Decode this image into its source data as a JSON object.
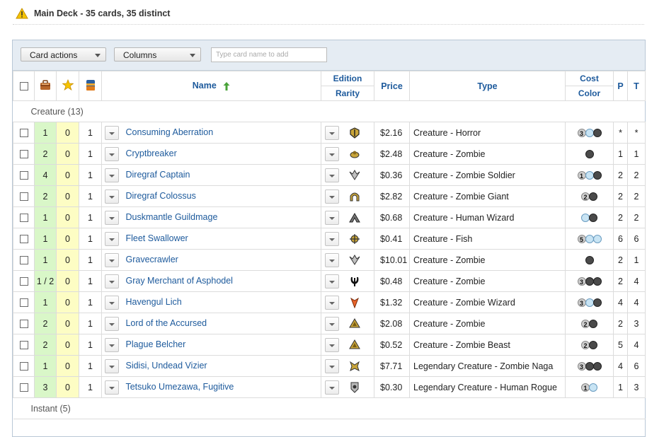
{
  "header": {
    "title": "Main Deck",
    "summary": " - 35 cards, 35 distinct"
  },
  "toolbar": {
    "card_actions_label": "Card actions",
    "columns_label": "Columns",
    "search_placeholder": "Type card name to add"
  },
  "columns": {
    "name": "Name",
    "edition": "Edition",
    "rarity": "Rarity",
    "price": "Price",
    "type": "Type",
    "cost": "Cost",
    "color": "Color",
    "p": "P",
    "t": "T"
  },
  "groups": [
    {
      "label": "Creature (13)"
    },
    {
      "label": "Instant (5)"
    }
  ],
  "colors": {
    "header_text": "#1d5a9c",
    "green_cell": "#d9f7c8",
    "yellow_cell": "#fdfdc4",
    "toolbar_bg": "#e5ecf3"
  },
  "cards": [
    {
      "have": "1",
      "want": "0",
      "qty": "1",
      "name": "Consuming Aberration",
      "edition_icon": "set-icon-gtc",
      "price": "$2.16",
      "type": "Creature - Horror",
      "cost": [
        [
          "num",
          "3"
        ],
        [
          "u",
          ""
        ],
        [
          "b",
          ""
        ]
      ],
      "p": "*",
      "t": "*"
    },
    {
      "have": "2",
      "want": "0",
      "qty": "1",
      "name": "Cryptbreaker",
      "edition_icon": "set-icon-emn",
      "price": "$2.48",
      "type": "Creature - Zombie",
      "cost": [
        [
          "b",
          ""
        ]
      ],
      "p": "1",
      "t": "1"
    },
    {
      "have": "4",
      "want": "0",
      "qty": "1",
      "name": "Diregraf Captain",
      "edition_icon": "set-icon-dka",
      "price": "$0.36",
      "type": "Creature - Zombie Soldier",
      "cost": [
        [
          "num",
          "1"
        ],
        [
          "u",
          ""
        ],
        [
          "b",
          ""
        ]
      ],
      "p": "2",
      "t": "2"
    },
    {
      "have": "2",
      "want": "0",
      "qty": "1",
      "name": "Diregraf Colossus",
      "edition_icon": "set-icon-soi",
      "price": "$2.82",
      "type": "Creature - Zombie Giant",
      "cost": [
        [
          "num",
          "2"
        ],
        [
          "b",
          ""
        ]
      ],
      "p": "2",
      "t": "2"
    },
    {
      "have": "1",
      "want": "0",
      "qty": "1",
      "name": "Duskmantle Guildmage",
      "edition_icon": "set-icon-rtr",
      "price": "$0.68",
      "type": "Creature - Human Wizard",
      "cost": [
        [
          "u",
          ""
        ],
        [
          "b",
          ""
        ]
      ],
      "p": "2",
      "t": "2"
    },
    {
      "have": "1",
      "want": "0",
      "qty": "1",
      "name": "Fleet Swallower",
      "edition_icon": "set-icon-zen",
      "price": "$0.41",
      "type": "Creature - Fish",
      "cost": [
        [
          "num",
          "5"
        ],
        [
          "u",
          ""
        ],
        [
          "u",
          ""
        ]
      ],
      "p": "6",
      "t": "6"
    },
    {
      "have": "1",
      "want": "0",
      "qty": "1",
      "name": "Gravecrawler",
      "edition_icon": "set-icon-dka",
      "price": "$10.01",
      "type": "Creature - Zombie",
      "cost": [
        [
          "b",
          ""
        ]
      ],
      "p": "2",
      "t": "1"
    },
    {
      "have": "1 / 2",
      "want": "0",
      "qty": "1",
      "name": "Gray Merchant of Asphodel",
      "edition_icon": "set-icon-ths",
      "price": "$0.48",
      "type": "Creature - Zombie",
      "cost": [
        [
          "num",
          "3"
        ],
        [
          "b",
          ""
        ],
        [
          "b",
          ""
        ]
      ],
      "p": "2",
      "t": "4"
    },
    {
      "have": "1",
      "want": "0",
      "qty": "1",
      "name": "Havengul Lich",
      "edition_icon": "set-icon-dka-rare",
      "price": "$1.32",
      "type": "Creature - Zombie Wizard",
      "cost": [
        [
          "num",
          "3"
        ],
        [
          "u",
          ""
        ],
        [
          "b",
          ""
        ]
      ],
      "p": "4",
      "t": "4"
    },
    {
      "have": "2",
      "want": "0",
      "qty": "1",
      "name": "Lord of the Accursed",
      "edition_icon": "set-icon-akh",
      "price": "$2.08",
      "type": "Creature - Zombie",
      "cost": [
        [
          "num",
          "2"
        ],
        [
          "b",
          ""
        ]
      ],
      "p": "2",
      "t": "3"
    },
    {
      "have": "2",
      "want": "0",
      "qty": "1",
      "name": "Plague Belcher",
      "edition_icon": "set-icon-akh",
      "price": "$0.52",
      "type": "Creature - Zombie Beast",
      "cost": [
        [
          "num",
          "2"
        ],
        [
          "b",
          ""
        ]
      ],
      "p": "5",
      "t": "4"
    },
    {
      "have": "1",
      "want": "0",
      "qty": "1",
      "name": "Sidisi, Undead Vizier",
      "edition_icon": "set-icon-dtk",
      "price": "$7.71",
      "type": "Legendary Creature - Zombie Naga",
      "cost": [
        [
          "num",
          "3"
        ],
        [
          "b",
          ""
        ],
        [
          "b",
          ""
        ]
      ],
      "p": "4",
      "t": "6"
    },
    {
      "have": "3",
      "want": "0",
      "qty": "1",
      "name": "Tetsuko Umezawa, Fugitive",
      "edition_icon": "set-icon-dom",
      "price": "$0.30",
      "type": "Legendary Creature - Human Rogue",
      "cost": [
        [
          "num",
          "1"
        ],
        [
          "u",
          ""
        ]
      ],
      "p": "1",
      "t": "3"
    }
  ]
}
